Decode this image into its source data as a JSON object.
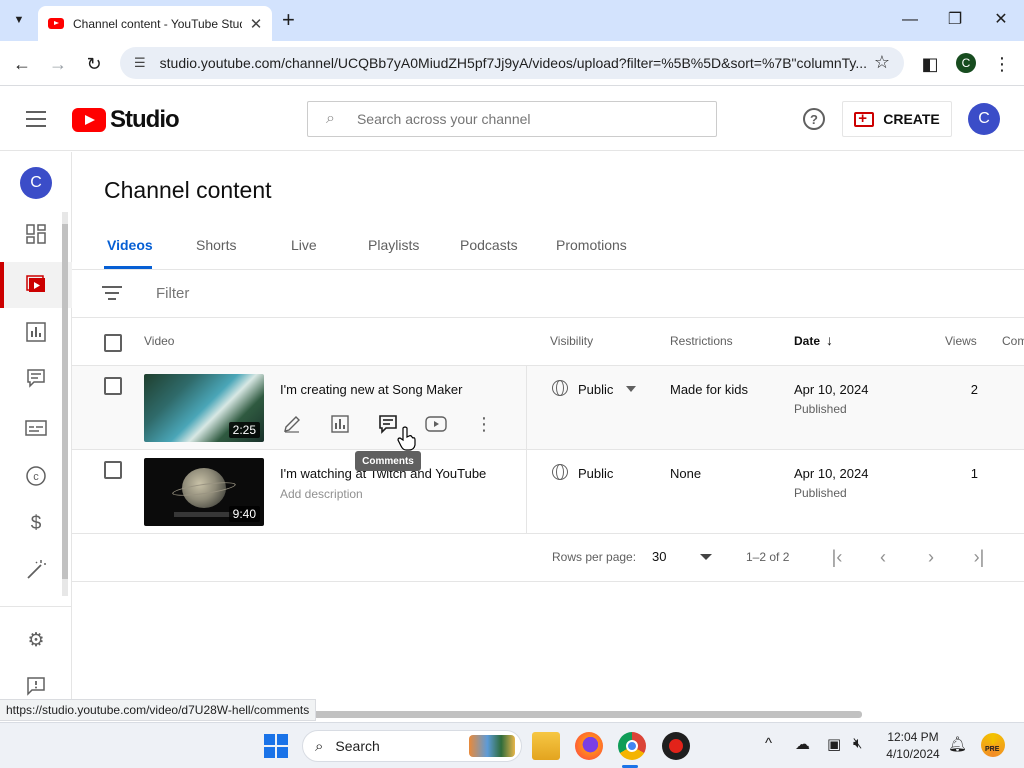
{
  "browser": {
    "tab_title": "Channel content - YouTube Studio",
    "url": "studio.youtube.com/channel/UCQBb7yA0MiudZH5pf7Jj9yA/videos/upload?filter=%5B%5D&sort=%7B\"columnTy...",
    "profile_initial": "C",
    "status_url": "https://studio.youtube.com/video/d7U28W-hell/comments"
  },
  "header": {
    "logo_text": "Studio",
    "search_placeholder": "Search across your channel",
    "create_label": "CREATE",
    "avatar_initial": "C"
  },
  "nav": {
    "avatar_initial": "C",
    "items": [
      {
        "name": "dashboard",
        "icon": "dashboard-icon"
      },
      {
        "name": "content",
        "icon": "content-icon",
        "active": true
      },
      {
        "name": "analytics",
        "icon": "analytics-icon"
      },
      {
        "name": "comments",
        "icon": "comments-icon"
      },
      {
        "name": "subtitles",
        "icon": "subtitles-icon"
      },
      {
        "name": "copyright",
        "icon": "copyright-icon"
      },
      {
        "name": "earn",
        "icon": "dollar-icon"
      },
      {
        "name": "customization",
        "icon": "magic-wand-icon"
      },
      {
        "name": "settings",
        "icon": "gear-icon"
      },
      {
        "name": "feedback",
        "icon": "feedback-icon"
      }
    ]
  },
  "page": {
    "title": "Channel content",
    "tabs": [
      "Videos",
      "Shorts",
      "Live",
      "Playlists",
      "Podcasts",
      "Promotions"
    ],
    "active_tab": "Videos",
    "filter_placeholder": "Filter"
  },
  "table": {
    "columns": {
      "video": "Video",
      "visibility": "Visibility",
      "restrictions": "Restrictions",
      "date": "Date",
      "views": "Views",
      "comments": "Com"
    },
    "rows": [
      {
        "title": "I'm creating new at Song Maker",
        "duration": "2:25",
        "visibility": "Public",
        "restrictions": "Made for kids",
        "date": "Apr 10, 2024",
        "date_status": "Published",
        "views": "2"
      },
      {
        "title": "I'm watching at Twitch and YouTube",
        "description": "Add description",
        "duration": "9:40",
        "visibility": "Public",
        "restrictions": "None",
        "date": "Apr 10, 2024",
        "date_status": "Published",
        "views": "1"
      }
    ],
    "tooltip": "Comments"
  },
  "pager": {
    "rows_per_page_label": "Rows per page:",
    "rows_per_page_value": "30",
    "range": "1–2 of 2"
  },
  "taskbar": {
    "search_label": "Search",
    "time": "12:04 PM",
    "date": "4/10/2024",
    "badge": "PRE"
  },
  "colors": {
    "accent_blue": "#065fd4",
    "youtube_red": "#ff0000",
    "active_nav_red": "#cc0000",
    "avatar_blue": "#3b4dc8"
  }
}
